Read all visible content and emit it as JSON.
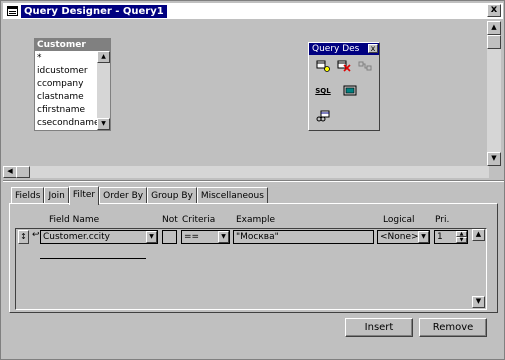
{
  "window": {
    "title": "Query Designer - Query1",
    "close_glyph": "x"
  },
  "table_window": {
    "title": "Customer",
    "fields": [
      "*",
      "idcustomer",
      "ccompany",
      "clastname",
      "cfirstname",
      "csecondname"
    ]
  },
  "toolbox": {
    "title": "Query Des",
    "close_glyph": "x",
    "sql_label": "SQL"
  },
  "tabs": [
    "Fields",
    "Join",
    "Filter",
    "Order By",
    "Group By",
    "Miscellaneous"
  ],
  "active_tab": "Filter",
  "filter": {
    "headers": {
      "field_name": "Field Name",
      "not": "Not",
      "criteria": "Criteria",
      "example": "Example",
      "logical": "Logical",
      "priority": "Pri."
    },
    "row": {
      "field_name": "Customer.ccity",
      "criteria": "==",
      "example": "\"Москва\"",
      "logical": "<None>",
      "priority": "1"
    }
  },
  "buttons": {
    "insert": "Insert",
    "remove": "Remove"
  },
  "icons": {
    "app": "query-designer-icon",
    "add_table": "add-table-icon",
    "remove_table": "remove-table-icon",
    "join": "join-icon",
    "sql": "sql-icon",
    "output": "output-icon",
    "options": "query-options-icon"
  },
  "colors": {
    "title_bg": "#000080",
    "title_fg": "#ffffff",
    "face": "#c0c0c0"
  }
}
